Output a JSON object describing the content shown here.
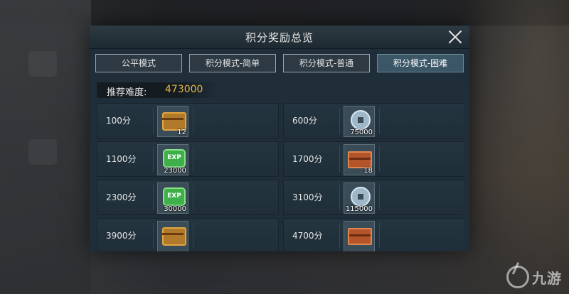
{
  "dialog": {
    "title": "积分奖励总览",
    "recommend_label": "推荐难度:",
    "recommend_value": "473000"
  },
  "tabs": [
    {
      "label": "公平模式",
      "active": false
    },
    {
      "label": "积分模式-简单",
      "active": false
    },
    {
      "label": "积分模式-普通",
      "active": false
    },
    {
      "label": "积分模式-困难",
      "active": true
    }
  ],
  "rewards": [
    {
      "score": "100分",
      "icon": "chest-icon",
      "qty": "12"
    },
    {
      "score": "600分",
      "icon": "coin-icon",
      "qty": "75000"
    },
    {
      "score": "1100分",
      "icon": "exp-icon",
      "qty": "23000"
    },
    {
      "score": "1700分",
      "icon": "box-icon",
      "qty": "18"
    },
    {
      "score": "2300分",
      "icon": "exp-icon",
      "qty": "30000"
    },
    {
      "score": "3100分",
      "icon": "coin-icon",
      "qty": "115000"
    },
    {
      "score": "3900分",
      "icon": "chest-icon",
      "qty": ""
    },
    {
      "score": "4700分",
      "icon": "box-icon",
      "qty": ""
    }
  ],
  "watermark": {
    "text": "九游"
  },
  "colors": {
    "accent": "#e3b64a",
    "panel": "#1f2e38",
    "active_tab": "#3b5767"
  }
}
